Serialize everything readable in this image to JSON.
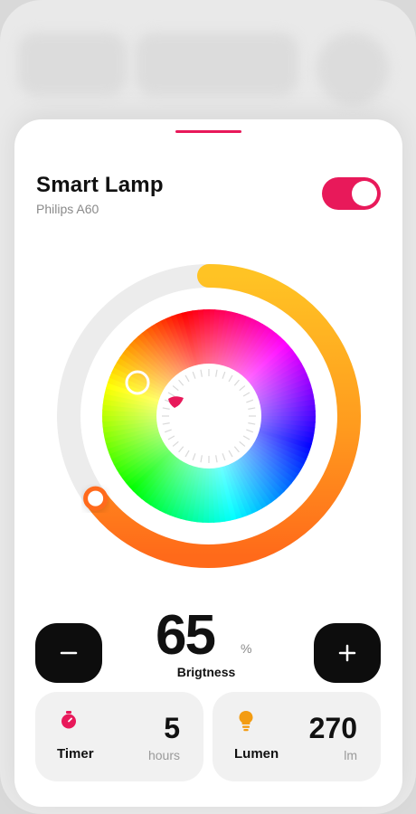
{
  "device": {
    "name": "Smart Lamp",
    "model": "Philips A60",
    "power_on": true
  },
  "brightness": {
    "value": "65",
    "unit": "%",
    "label": "Brigtness",
    "level_fraction": 0.65,
    "decrease_icon": "minus-icon",
    "increase_icon": "plus-icon"
  },
  "color_wheel": {
    "selected_color": "#ff7a1a"
  },
  "cards": [
    {
      "title": "Timer",
      "value": "5",
      "unit": "hours",
      "icon": "stopwatch-icon",
      "icon_color": "#e8195a"
    },
    {
      "title": "Lumen",
      "value": "270",
      "unit": "lm",
      "icon": "lightbulb-icon",
      "icon_color": "#f39c12"
    }
  ],
  "colors": {
    "accent": "#e8195a",
    "ring_start": "#ffbf22",
    "ring_end": "#ff6a1a",
    "button_bg": "#0d0d0d"
  }
}
